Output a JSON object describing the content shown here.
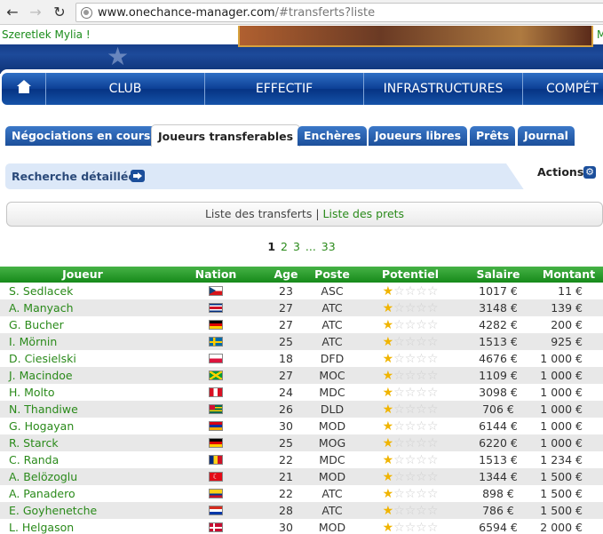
{
  "browser": {
    "url_host": "www.onechance-manager.com",
    "url_path": "/#transferts?liste"
  },
  "header": {
    "welcome": "Szeretlek Mylia !",
    "welcome_right": "M"
  },
  "menu": {
    "home_icon": "house-icon",
    "items": [
      "CLUB",
      "EFFECTIF",
      "INFRASTRUCTURES",
      "COMPÉT"
    ]
  },
  "tabs": [
    {
      "label": "Négociations en cours",
      "active": false
    },
    {
      "label": "Joueurs transferables",
      "active": true
    },
    {
      "label": "Enchères",
      "active": false
    },
    {
      "label": "Joueurs libres",
      "active": false
    },
    {
      "label": "Prêts",
      "active": false
    },
    {
      "label": "Journal",
      "active": false
    }
  ],
  "search": {
    "label": "Recherche détaillée",
    "actions_label": "Actions"
  },
  "list_switch": {
    "current": "Liste des transferts",
    "separator": "|",
    "other": "Liste des prets"
  },
  "pagination": {
    "pages": [
      "1",
      "2",
      "3",
      "...",
      "33"
    ],
    "current": "1"
  },
  "table": {
    "headers": [
      "Joueur",
      "Nation",
      "Age",
      "Poste",
      "Potentiel",
      "Salaire",
      "Montant"
    ],
    "rows": [
      {
        "name": "S. Sedlacek",
        "flag": "cz",
        "age": "23",
        "poste": "ASC",
        "stars": 1,
        "salaire": "1017 €",
        "montant": "11 €"
      },
      {
        "name": "A. Manyach",
        "flag": "cr",
        "age": "27",
        "poste": "ATC",
        "stars": 1,
        "salaire": "3148 €",
        "montant": "139 €"
      },
      {
        "name": "G. Bucher",
        "flag": "de",
        "age": "27",
        "poste": "ATC",
        "stars": 1,
        "salaire": "4282 €",
        "montant": "200 €"
      },
      {
        "name": "I. Mörnin",
        "flag": "se",
        "age": "25",
        "poste": "ATC",
        "stars": 1,
        "salaire": "1513 €",
        "montant": "925 €"
      },
      {
        "name": "D. Ciesielski",
        "flag": "pl",
        "age": "18",
        "poste": "DFD",
        "stars": 1,
        "salaire": "4676 €",
        "montant": "1 000 €"
      },
      {
        "name": "J. Macindoe",
        "flag": "jm",
        "age": "27",
        "poste": "MOC",
        "stars": 1,
        "salaire": "1109 €",
        "montant": "1 000 €"
      },
      {
        "name": "H. Molto",
        "flag": "pe",
        "age": "24",
        "poste": "MDC",
        "stars": 1,
        "salaire": "3098 €",
        "montant": "1 000 €"
      },
      {
        "name": "N. Thandiwe",
        "flag": "tg",
        "age": "26",
        "poste": "DLD",
        "stars": 1,
        "salaire": "706 €",
        "montant": "1 000 €"
      },
      {
        "name": "G. Hogayan",
        "flag": "am",
        "age": "30",
        "poste": "MOD",
        "stars": 1,
        "salaire": "6144 €",
        "montant": "1 000 €"
      },
      {
        "name": "R. Starck",
        "flag": "de",
        "age": "25",
        "poste": "MOG",
        "stars": 1,
        "salaire": "6220 €",
        "montant": "1 000 €"
      },
      {
        "name": "C. Randa",
        "flag": "ro",
        "age": "22",
        "poste": "MDC",
        "stars": 1,
        "salaire": "1513 €",
        "montant": "1 234 €"
      },
      {
        "name": "A. Belözoglu",
        "flag": "tr",
        "age": "21",
        "poste": "MOD",
        "stars": 1,
        "salaire": "1344 €",
        "montant": "1 500 €"
      },
      {
        "name": "A. Panadero",
        "flag": "co",
        "age": "22",
        "poste": "ATC",
        "stars": 1,
        "salaire": "898 €",
        "montant": "1 500 €"
      },
      {
        "name": "E. Goyhenetche",
        "flag": "py",
        "age": "28",
        "poste": "ATC",
        "stars": 1,
        "salaire": "786 €",
        "montant": "1 500 €"
      },
      {
        "name": "L. Helgason",
        "flag": "dk",
        "age": "30",
        "poste": "MOD",
        "stars": 1,
        "salaire": "6594 €",
        "montant": "2 000 €"
      }
    ]
  },
  "colors": {
    "menu_blue": "#0c3f95",
    "link_green": "#2a8a1a",
    "header_green": "#168a1a",
    "star_gold": "#f0b400"
  }
}
